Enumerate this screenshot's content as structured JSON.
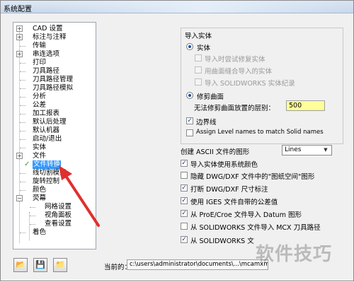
{
  "window": {
    "title": "系统配置"
  },
  "tree": {
    "items": [
      {
        "label": "CAD 设置",
        "expandable": true
      },
      {
        "label": "标注与注释",
        "expandable": true
      },
      {
        "label": "传输",
        "expandable": false
      },
      {
        "label": "串连选项",
        "expandable": true
      },
      {
        "label": "打印",
        "expandable": false
      },
      {
        "label": "刀具路径",
        "expandable": false
      },
      {
        "label": "刀具路径管理",
        "expandable": false
      },
      {
        "label": "刀具路径模拟",
        "expandable": false
      },
      {
        "label": "分析",
        "expandable": false
      },
      {
        "label": "公差",
        "expandable": false
      },
      {
        "label": "加工报表",
        "expandable": false
      },
      {
        "label": "默认后处理",
        "expandable": false
      },
      {
        "label": "默认机器",
        "expandable": false
      },
      {
        "label": "启动/退出",
        "expandable": false
      },
      {
        "label": "实体",
        "expandable": false
      },
      {
        "label": "文件",
        "expandable": true
      },
      {
        "label": "文件转换",
        "expandable": false,
        "selected": true
      },
      {
        "label": "线切割模拟",
        "expandable": false
      },
      {
        "label": "旋转控制",
        "expandable": false
      },
      {
        "label": "颜色",
        "expandable": false
      },
      {
        "label": "荧幕",
        "expandable": true
      },
      {
        "label": "网格设置",
        "expandable": false
      },
      {
        "label": "视角面板",
        "expandable": false
      },
      {
        "label": "查看设置",
        "expandable": false
      },
      {
        "label": "着色",
        "expandable": false
      }
    ]
  },
  "import_solids": {
    "title": "导入实体",
    "solid_option": "实体",
    "try_repair": "导入时尝试修复实体",
    "stitch_surfaces": "用曲面缝合导入的实体",
    "import_solidworks_history": "导入  SOLIDWORKS 实体纪录",
    "trimmed_surface_option": "修剪曲面",
    "layer_label": "无法修剪曲面放置的层别：",
    "layer_value": "500",
    "edge_curves": "边界线",
    "assign_level_names": "Assign Level names to match Solid names"
  },
  "options": {
    "ascii_label": "创建 ASCII 文件的图形",
    "ascii_select_value": "Lines",
    "items": [
      {
        "label": "导入实体使用系统颜色",
        "checked": true
      },
      {
        "label": "隐藏 DWG/DXF 文件中的\"图纸空间\"图形",
        "checked": false
      },
      {
        "label": "打断 DWG/DXF 尺寸标注",
        "checked": true
      },
      {
        "label": "使用 IGES 文件自带的公差值",
        "checked": true
      },
      {
        "label": "从 ProE/Croe 文件导入 Datum 图形",
        "checked": true
      },
      {
        "label": "从 SOLIDWORKS 文件导入 MCX 刀具路径",
        "checked": false
      },
      {
        "label": "从 SOLIDWORKS 文",
        "checked": true
      }
    ]
  },
  "bottom": {
    "current_label": "当前的：",
    "current_path": "c:\\users\\administrator\\documents\\...\\mcamxm"
  },
  "watermark": {
    "text": "软件技巧"
  }
}
